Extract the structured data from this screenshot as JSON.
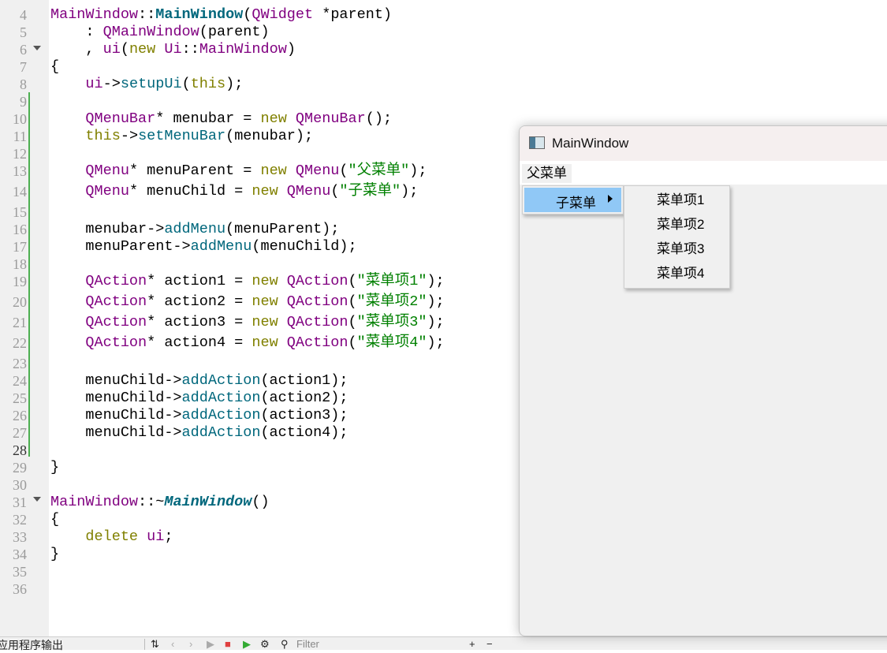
{
  "editor": {
    "line_numbers": [
      "4",
      "5",
      "6",
      "7",
      "8",
      "9",
      "10",
      "11",
      "12",
      "13",
      "14",
      "15",
      "16",
      "17",
      "18",
      "19",
      "20",
      "21",
      "22",
      "23",
      "24",
      "25",
      "26",
      "27",
      "28",
      "29",
      "30",
      "31",
      "32",
      "33",
      "34",
      "35",
      "36"
    ],
    "lines": [
      [
        [
          "t",
          "MainWindow"
        ],
        [
          "pl",
          "::"
        ],
        [
          "fb",
          "MainWindow"
        ],
        [
          "pl",
          "("
        ],
        [
          "t",
          "QWidget"
        ],
        [
          "pl",
          " *parent)"
        ]
      ],
      [
        [
          "pl",
          "    : "
        ],
        [
          "t",
          "QMainWindow"
        ],
        [
          "pl",
          "(parent)"
        ]
      ],
      [
        [
          "pl",
          "    , "
        ],
        [
          "t",
          "ui"
        ],
        [
          "pl",
          "("
        ],
        [
          "kw",
          "new"
        ],
        [
          "pl",
          " "
        ],
        [
          "t",
          "Ui"
        ],
        [
          "pl",
          "::"
        ],
        [
          "t",
          "MainWindow"
        ],
        [
          "pl",
          ")"
        ]
      ],
      [
        [
          "pl",
          "{"
        ]
      ],
      [
        [
          "pl",
          "    "
        ],
        [
          "t",
          "ui"
        ],
        [
          "pl",
          "->"
        ],
        [
          "fn",
          "setupUi"
        ],
        [
          "pl",
          "("
        ],
        [
          "kw",
          "this"
        ],
        [
          "pl",
          ");"
        ]
      ],
      [],
      [
        [
          "pl",
          "    "
        ],
        [
          "t",
          "QMenuBar"
        ],
        [
          "pl",
          "* menubar = "
        ],
        [
          "kw",
          "new"
        ],
        [
          "pl",
          " "
        ],
        [
          "t",
          "QMenuBar"
        ],
        [
          "pl",
          "();"
        ]
      ],
      [
        [
          "pl",
          "    "
        ],
        [
          "kw",
          "this"
        ],
        [
          "pl",
          "->"
        ],
        [
          "fn",
          "setMenuBar"
        ],
        [
          "pl",
          "(menubar);"
        ]
      ],
      [],
      [
        [
          "pl",
          "    "
        ],
        [
          "t",
          "QMenu"
        ],
        [
          "pl",
          "* menuParent = "
        ],
        [
          "kw",
          "new"
        ],
        [
          "pl",
          " "
        ],
        [
          "t",
          "QMenu"
        ],
        [
          "pl",
          "("
        ],
        [
          "st",
          "\"父菜单\""
        ],
        [
          "pl",
          ");"
        ]
      ],
      [
        [
          "pl",
          "    "
        ],
        [
          "t",
          "QMenu"
        ],
        [
          "pl",
          "* menuChild = "
        ],
        [
          "kw",
          "new"
        ],
        [
          "pl",
          " "
        ],
        [
          "t",
          "QMenu"
        ],
        [
          "pl",
          "("
        ],
        [
          "st",
          "\"子菜单\""
        ],
        [
          "pl",
          ");"
        ]
      ],
      [],
      [
        [
          "pl",
          "    menubar->"
        ],
        [
          "fn",
          "addMenu"
        ],
        [
          "pl",
          "(menuParent);"
        ]
      ],
      [
        [
          "pl",
          "    menuParent->"
        ],
        [
          "fn",
          "addMenu"
        ],
        [
          "pl",
          "(menuChild);"
        ]
      ],
      [],
      [
        [
          "pl",
          "    "
        ],
        [
          "t",
          "QAction"
        ],
        [
          "pl",
          "* action1 = "
        ],
        [
          "kw",
          "new"
        ],
        [
          "pl",
          " "
        ],
        [
          "t",
          "QAction"
        ],
        [
          "pl",
          "("
        ],
        [
          "st",
          "\"菜单项1\""
        ],
        [
          "pl",
          ");"
        ]
      ],
      [
        [
          "pl",
          "    "
        ],
        [
          "t",
          "QAction"
        ],
        [
          "pl",
          "* action2 = "
        ],
        [
          "kw",
          "new"
        ],
        [
          "pl",
          " "
        ],
        [
          "t",
          "QAction"
        ],
        [
          "pl",
          "("
        ],
        [
          "st",
          "\"菜单项2\""
        ],
        [
          "pl",
          ");"
        ]
      ],
      [
        [
          "pl",
          "    "
        ],
        [
          "t",
          "QAction"
        ],
        [
          "pl",
          "* action3 = "
        ],
        [
          "kw",
          "new"
        ],
        [
          "pl",
          " "
        ],
        [
          "t",
          "QAction"
        ],
        [
          "pl",
          "("
        ],
        [
          "st",
          "\"菜单项3\""
        ],
        [
          "pl",
          ");"
        ]
      ],
      [
        [
          "pl",
          "    "
        ],
        [
          "t",
          "QAction"
        ],
        [
          "pl",
          "* action4 = "
        ],
        [
          "kw",
          "new"
        ],
        [
          "pl",
          " "
        ],
        [
          "t",
          "QAction"
        ],
        [
          "pl",
          "("
        ],
        [
          "st",
          "\"菜单项4\""
        ],
        [
          "pl",
          ");"
        ]
      ],
      [],
      [
        [
          "pl",
          "    menuChild->"
        ],
        [
          "fn",
          "addAction"
        ],
        [
          "pl",
          "(action1);"
        ]
      ],
      [
        [
          "pl",
          "    menuChild->"
        ],
        [
          "fn",
          "addAction"
        ],
        [
          "pl",
          "(action2);"
        ]
      ],
      [
        [
          "pl",
          "    menuChild->"
        ],
        [
          "fn",
          "addAction"
        ],
        [
          "pl",
          "(action3);"
        ]
      ],
      [
        [
          "pl",
          "    menuChild->"
        ],
        [
          "fn",
          "addAction"
        ],
        [
          "pl",
          "(action4);"
        ]
      ],
      [],
      [
        [
          "pl",
          "}"
        ]
      ],
      [],
      [
        [
          "t",
          "MainWindow"
        ],
        [
          "pl",
          "::~"
        ],
        [
          "fi",
          "MainWindow"
        ],
        [
          "pl",
          "()"
        ]
      ],
      [
        [
          "pl",
          "{"
        ]
      ],
      [
        [
          "pl",
          "    "
        ],
        [
          "kw",
          "delete"
        ],
        [
          "pl",
          " "
        ],
        [
          "t",
          "ui"
        ],
        [
          "pl",
          ";"
        ]
      ],
      [
        [
          "pl",
          "}"
        ]
      ],
      [],
      []
    ]
  },
  "bottom_panel": {
    "label": "应用程序输出",
    "filter_placeholder": "Filter"
  },
  "app_window": {
    "title": "MainWindow",
    "menubar_item": "父菜单",
    "submenu_label": "子菜单",
    "submenu_items": [
      "菜单项1",
      "菜单项2",
      "菜单项3",
      "菜单项4"
    ]
  },
  "colors": {
    "type": "#800080",
    "keyword": "#808000",
    "function": "#00677c",
    "string": "#008000",
    "highlight": "#90c8f6"
  }
}
